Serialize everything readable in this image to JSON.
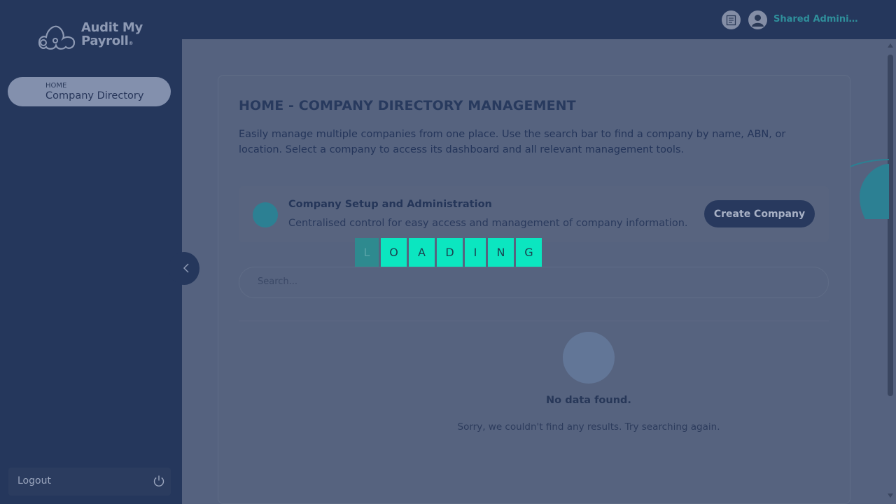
{
  "brand": {
    "line1": "Audit My",
    "line2": "Payroll",
    "reg": "®"
  },
  "sidebar": {
    "nav": {
      "small": "HOME",
      "label": "Company Directory"
    },
    "logout": "Logout"
  },
  "topbar": {
    "user_name": "Shared Administr..."
  },
  "page": {
    "title": "HOME - COMPANY DIRECTORY MANAGEMENT",
    "description": "Easily manage multiple companies from one place. Use the search bar to find a company by name, ABN, or location. Select a company to access its dashboard and all relevant management tools."
  },
  "setup": {
    "title": "Company Setup and Administration",
    "description": "Centralised control for easy access and management of company information.",
    "button": "Create Company"
  },
  "search": {
    "placeholder": "Search..."
  },
  "empty": {
    "title": "No data found.",
    "subtitle": "Sorry, we couldn't find any results. Try searching again."
  },
  "loading": [
    "L",
    "O",
    "A",
    "D",
    "I",
    "N",
    "G"
  ],
  "colors": {
    "accent": "#0be6c0",
    "sidebar": "#25375c",
    "overlay": "#55627f"
  },
  "icons": [
    "logo-icon",
    "document-icon",
    "user-icon",
    "chevron-left-icon",
    "power-icon"
  ]
}
